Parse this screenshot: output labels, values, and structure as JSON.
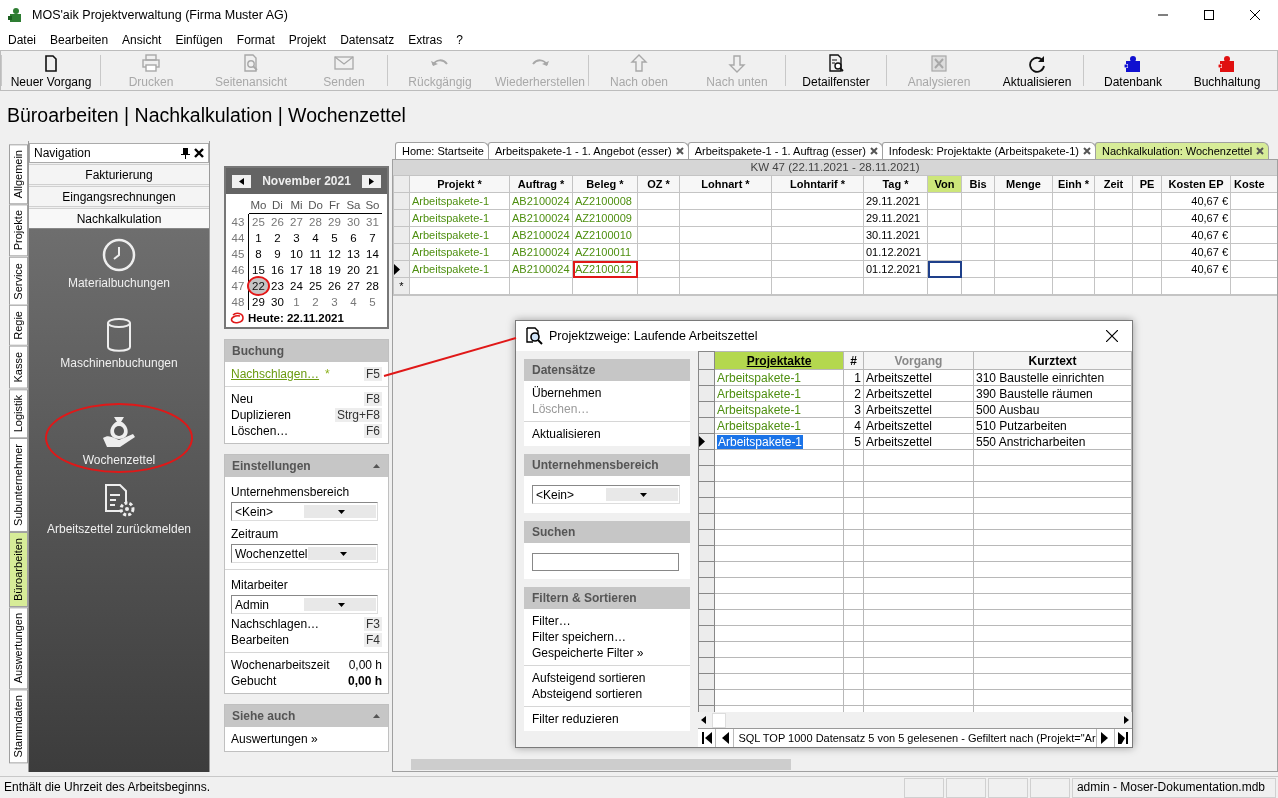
{
  "window": {
    "title": "MOS'aik Projektverwaltung (Firma Muster AG)"
  },
  "menu": [
    "Datei",
    "Bearbeiten",
    "Ansicht",
    "Einfügen",
    "Format",
    "Projekt",
    "Datensatz",
    "Extras",
    "?"
  ],
  "toolbar_groups": [
    {
      "buttons": [
        {
          "label": "Neuer Vorgang",
          "disabled": false
        }
      ]
    },
    {
      "buttons": [
        {
          "label": "Drucken",
          "disabled": true
        },
        {
          "label": "Seitenansicht",
          "disabled": true
        },
        {
          "label": "Senden",
          "disabled": true
        }
      ]
    },
    {
      "buttons": [
        {
          "label": "Rückgängig",
          "disabled": true
        },
        {
          "label": "Wiederherstellen",
          "disabled": true
        }
      ]
    },
    {
      "buttons": [
        {
          "label": "Nach oben",
          "disabled": true
        },
        {
          "label": "Nach unten",
          "disabled": true
        }
      ]
    },
    {
      "buttons": [
        {
          "label": "Detailfenster",
          "disabled": false
        }
      ]
    },
    {
      "buttons": [
        {
          "label": "Analysieren",
          "disabled": true
        },
        {
          "label": "Aktualisieren",
          "disabled": false
        }
      ]
    },
    {
      "buttons": [
        {
          "label": "Datenbank",
          "disabled": false
        },
        {
          "label": "Buchhaltung",
          "disabled": false
        }
      ]
    }
  ],
  "breadcrumb": "Büroarbeiten | Nachkalkulation | Wochenzettel",
  "nav_rail": [
    {
      "label": "Allgemein",
      "selected": false
    },
    {
      "label": "Projekte",
      "selected": false
    },
    {
      "label": "Service",
      "selected": false
    },
    {
      "label": "Regie",
      "selected": false
    },
    {
      "label": "Kasse",
      "selected": false
    },
    {
      "label": "Logistik",
      "selected": false
    },
    {
      "label": "Subunternehmer",
      "selected": false
    },
    {
      "label": "Büroarbeiten",
      "selected": true
    },
    {
      "label": "Auswertungen",
      "selected": false
    },
    {
      "label": "Stammdaten",
      "selected": false
    }
  ],
  "navigation": {
    "title": "Navigation",
    "sections": [
      {
        "label": "Fakturierung",
        "expanded": false
      },
      {
        "label": "Eingangsrechnungen",
        "expanded": false
      },
      {
        "label": "Nachkalkulation",
        "expanded": true
      }
    ],
    "items": [
      {
        "label": "Materialbuchungen",
        "circled": false
      },
      {
        "label": "Maschinenbuchungen",
        "circled": false
      },
      {
        "label": "Wochenzettel",
        "circled": true
      },
      {
        "label": "Arbeitszettel zurückmelden",
        "circled": false
      }
    ]
  },
  "calendar": {
    "month": "November 2021",
    "weekdays": [
      "Mo",
      "Di",
      "Mi",
      "Do",
      "Fr",
      "Sa",
      "So"
    ],
    "weeks": [
      {
        "number": "43",
        "days": [
          {
            "day": "25",
            "other_month": true,
            "today": false
          },
          {
            "day": "26",
            "other_month": true,
            "today": false
          },
          {
            "day": "27",
            "other_month": true,
            "today": false
          },
          {
            "day": "28",
            "other_month": true,
            "today": false
          },
          {
            "day": "29",
            "other_month": true,
            "today": false
          },
          {
            "day": "30",
            "other_month": true,
            "today": false
          },
          {
            "day": "31",
            "other_month": true,
            "today": false
          }
        ]
      },
      {
        "number": "44",
        "days": [
          {
            "day": "1",
            "other_month": false,
            "today": false
          },
          {
            "day": "2",
            "other_month": false,
            "today": false
          },
          {
            "day": "3",
            "other_month": false,
            "today": false
          },
          {
            "day": "4",
            "other_month": false,
            "today": false
          },
          {
            "day": "5",
            "other_month": false,
            "today": false
          },
          {
            "day": "6",
            "other_month": false,
            "today": false
          },
          {
            "day": "7",
            "other_month": false,
            "today": false
          }
        ]
      },
      {
        "number": "45",
        "days": [
          {
            "day": "8",
            "other_month": false,
            "today": false
          },
          {
            "day": "9",
            "other_month": false,
            "today": false
          },
          {
            "day": "10",
            "other_month": false,
            "today": false
          },
          {
            "day": "11",
            "other_month": false,
            "today": false
          },
          {
            "day": "12",
            "other_month": false,
            "today": false
          },
          {
            "day": "13",
            "other_month": false,
            "today": false
          },
          {
            "day": "14",
            "other_month": false,
            "today": false
          }
        ]
      },
      {
        "number": "46",
        "days": [
          {
            "day": "15",
            "other_month": false,
            "today": false
          },
          {
            "day": "16",
            "other_month": false,
            "today": false
          },
          {
            "day": "17",
            "other_month": false,
            "today": false
          },
          {
            "day": "18",
            "other_month": false,
            "today": false
          },
          {
            "day": "19",
            "other_month": false,
            "today": false
          },
          {
            "day": "20",
            "other_month": false,
            "today": false
          },
          {
            "day": "21",
            "other_month": false,
            "today": false
          }
        ]
      },
      {
        "number": "47",
        "days": [
          {
            "day": "22",
            "other_month": false,
            "today": true
          },
          {
            "day": "23",
            "other_month": false,
            "today": false
          },
          {
            "day": "24",
            "other_month": false,
            "today": false
          },
          {
            "day": "25",
            "other_month": false,
            "today": false
          },
          {
            "day": "26",
            "other_month": false,
            "today": false
          },
          {
            "day": "27",
            "other_month": false,
            "today": false
          },
          {
            "day": "28",
            "other_month": false,
            "today": false
          }
        ]
      },
      {
        "number": "48",
        "days": [
          {
            "day": "29",
            "other_month": false,
            "today": false
          },
          {
            "day": "30",
            "other_month": false,
            "today": false
          },
          {
            "day": "1",
            "other_month": true,
            "today": false
          },
          {
            "day": "2",
            "other_month": true,
            "today": false
          },
          {
            "day": "3",
            "other_month": true,
            "today": false
          },
          {
            "day": "4",
            "other_month": true,
            "today": false
          },
          {
            "day": "5",
            "other_month": true,
            "today": false
          }
        ]
      }
    ],
    "today_label": "Heute: 22.11.2021"
  },
  "booking": {
    "title": "Buchung",
    "groups": [
      {
        "items": [
          {
            "label": "Nachschlagen…",
            "marker": "*",
            "key": "F5",
            "link": true
          }
        ]
      },
      {
        "items": [
          {
            "label": "Neu",
            "key": "F8",
            "link": false
          },
          {
            "label": "Duplizieren",
            "key": "Strg+F8",
            "link": false
          },
          {
            "label": "Löschen…",
            "key": "F6",
            "link": false
          }
        ]
      }
    ]
  },
  "settings": {
    "title": "Einstellungen",
    "expanded": true,
    "fields": [
      {
        "label": "Unternehmensbereich",
        "value": "<Kein>"
      },
      {
        "label": "Zeitraum",
        "value": "Wochenzettel"
      }
    ],
    "staff": {
      "label": "Mitarbeiter",
      "value": "Admin"
    },
    "actions": [
      {
        "label": "Nachschlagen…",
        "key": "F3"
      },
      {
        "label": "Bearbeiten",
        "key": "F4"
      }
    ],
    "totals": [
      {
        "label": "Wochenarbeitszeit",
        "value": "0,00 h",
        "bold": false
      },
      {
        "label": "Gebucht",
        "value": "0,00 h",
        "bold": true
      }
    ]
  },
  "see_also": {
    "title": "Siehe auch",
    "expanded": true,
    "links": [
      "Auswertungen »"
    ]
  },
  "doc_tabs": [
    {
      "label": "Home: Startseite",
      "closable": false,
      "selected": false
    },
    {
      "label": "Arbeitspakete-1 - 1. Angebot (esser)",
      "closable": true,
      "selected": false
    },
    {
      "label": "Arbeitspakete-1 - 1. Auftrag (esser)",
      "closable": true,
      "selected": false
    },
    {
      "label": "Infodesk: Projektakte (Arbeitspakete-1)",
      "closable": true,
      "selected": false
    },
    {
      "label": "Nachkalkulation: Wochenzettel",
      "closable": true,
      "selected": true
    }
  ],
  "grid": {
    "caption": "KW 47 (22.11.2021 - 28.11.2021)",
    "columns": [
      {
        "label": "Projekt *",
        "highlighted": false,
        "link": true
      },
      {
        "label": "Auftrag *",
        "highlighted": false,
        "link": true
      },
      {
        "label": "Beleg *",
        "highlighted": false,
        "link": true
      },
      {
        "label": "OZ *",
        "highlighted": false,
        "link": false
      },
      {
        "label": "Lohnart *",
        "highlighted": false,
        "link": false
      },
      {
        "label": "Lohntarif *",
        "highlighted": false,
        "link": false
      },
      {
        "label": "Tag *",
        "highlighted": false,
        "link": false
      },
      {
        "label": "Von",
        "highlighted": true,
        "link": false
      },
      {
        "label": "Bis",
        "highlighted": false,
        "link": false
      },
      {
        "label": "Menge",
        "highlighted": false,
        "link": false
      },
      {
        "label": "Einh *",
        "highlighted": false,
        "link": false
      },
      {
        "label": "Zeit",
        "highlighted": false,
        "link": false
      },
      {
        "label": "PE",
        "highlighted": false,
        "link": false
      },
      {
        "label": "Kosten EP",
        "highlighted": false,
        "link": false
      },
      {
        "label": "Koste",
        "highlighted": false,
        "link": false
      }
    ],
    "rows": [
      {
        "selected": false,
        "beleg_marked": false,
        "von_focused": false,
        "projekt": "Arbeitspakete-1",
        "auftrag": "AB2100024",
        "beleg": "AZ2100008",
        "tag": "29.11.2021",
        "kosten_ep": "40,67 €"
      },
      {
        "selected": false,
        "beleg_marked": false,
        "von_focused": false,
        "projekt": "Arbeitspakete-1",
        "auftrag": "AB2100024",
        "beleg": "AZ2100009",
        "tag": "29.11.2021",
        "kosten_ep": "40,67 €"
      },
      {
        "selected": false,
        "beleg_marked": false,
        "von_focused": false,
        "projekt": "Arbeitspakete-1",
        "auftrag": "AB2100024",
        "beleg": "AZ2100010",
        "tag": "30.11.2021",
        "kosten_ep": "40,67 €"
      },
      {
        "selected": false,
        "beleg_marked": false,
        "von_focused": false,
        "projekt": "Arbeitspakete-1",
        "auftrag": "AB2100024",
        "beleg": "AZ2100011",
        "tag": "01.12.2021",
        "kosten_ep": "40,67 €"
      },
      {
        "selected": true,
        "beleg_marked": true,
        "von_focused": true,
        "projekt": "Arbeitspakete-1",
        "auftrag": "AB2100024",
        "beleg": "AZ2100012",
        "tag": "01.12.2021",
        "kosten_ep": "40,67 €"
      }
    ],
    "new_row_marker": "*"
  },
  "dialog": {
    "title": "Projektzweige: Laufende Arbeitszettel",
    "pointer": true,
    "panels": [
      {
        "title": "Datensätze",
        "kind": "actions",
        "groups": [
          {
            "items": [
              {
                "label": "Übernehmen",
                "disabled": false
              },
              {
                "label": "Löschen…",
                "disabled": true
              }
            ]
          },
          {
            "items": [
              {
                "label": "Aktualisieren",
                "disabled": false
              }
            ]
          }
        ]
      },
      {
        "title": "Unternehmensbereich",
        "kind": "dropdown",
        "value": "<Kein>"
      },
      {
        "title": "Suchen",
        "kind": "search"
      },
      {
        "title": "Filtern & Sortieren",
        "kind": "actions",
        "groups": [
          {
            "items": [
              {
                "label": "Filter…",
                "disabled": false
              },
              {
                "label": "Filter speichern…",
                "disabled": false
              },
              {
                "label": "Gespeicherte Filter »",
                "disabled": false
              }
            ]
          },
          {
            "items": [
              {
                "label": "Aufsteigend sortieren",
                "disabled": false
              },
              {
                "label": "Absteigend sortieren",
                "disabled": false
              }
            ]
          },
          {
            "items": [
              {
                "label": "Filter reduzieren",
                "disabled": false
              }
            ]
          }
        ]
      }
    ],
    "columns": [
      {
        "label": "Projektakte",
        "sorted": true,
        "dimmed": false
      },
      {
        "label": "#",
        "sorted": false,
        "dimmed": false
      },
      {
        "label": "Vorgang",
        "sorted": false,
        "dimmed": true
      },
      {
        "label": "Kurztext",
        "sorted": false,
        "dimmed": false
      }
    ],
    "rows": [
      {
        "selected": false,
        "cells": [
          "Arbeitspakete-1",
          "1",
          "Arbeitszettel",
          "310 Baustelle einrichten"
        ]
      },
      {
        "selected": false,
        "cells": [
          "Arbeitspakete-1",
          "2",
          "Arbeitszettel",
          "390 Baustelle räumen"
        ]
      },
      {
        "selected": false,
        "cells": [
          "Arbeitspakete-1",
          "3",
          "Arbeitszettel",
          "500 Ausbau"
        ]
      },
      {
        "selected": false,
        "cells": [
          "Arbeitspakete-1",
          "4",
          "Arbeitszettel",
          "510 Putzarbeiten"
        ]
      },
      {
        "selected": true,
        "cells": [
          "Arbeitspakete-1",
          "5",
          "Arbeitszettel",
          "550 Anstricharbeiten"
        ]
      }
    ],
    "navigator": "SQL TOP 1000 Datensatz 5 von 5 gelesenen - Gefiltert nach (Projekt=\"Ar"
  },
  "status_bar": {
    "message": "Enthält die Uhrzeit des Arbeitsbeginns.",
    "panels": [
      "admin - Moser-Dokumentation.mdb"
    ]
  }
}
